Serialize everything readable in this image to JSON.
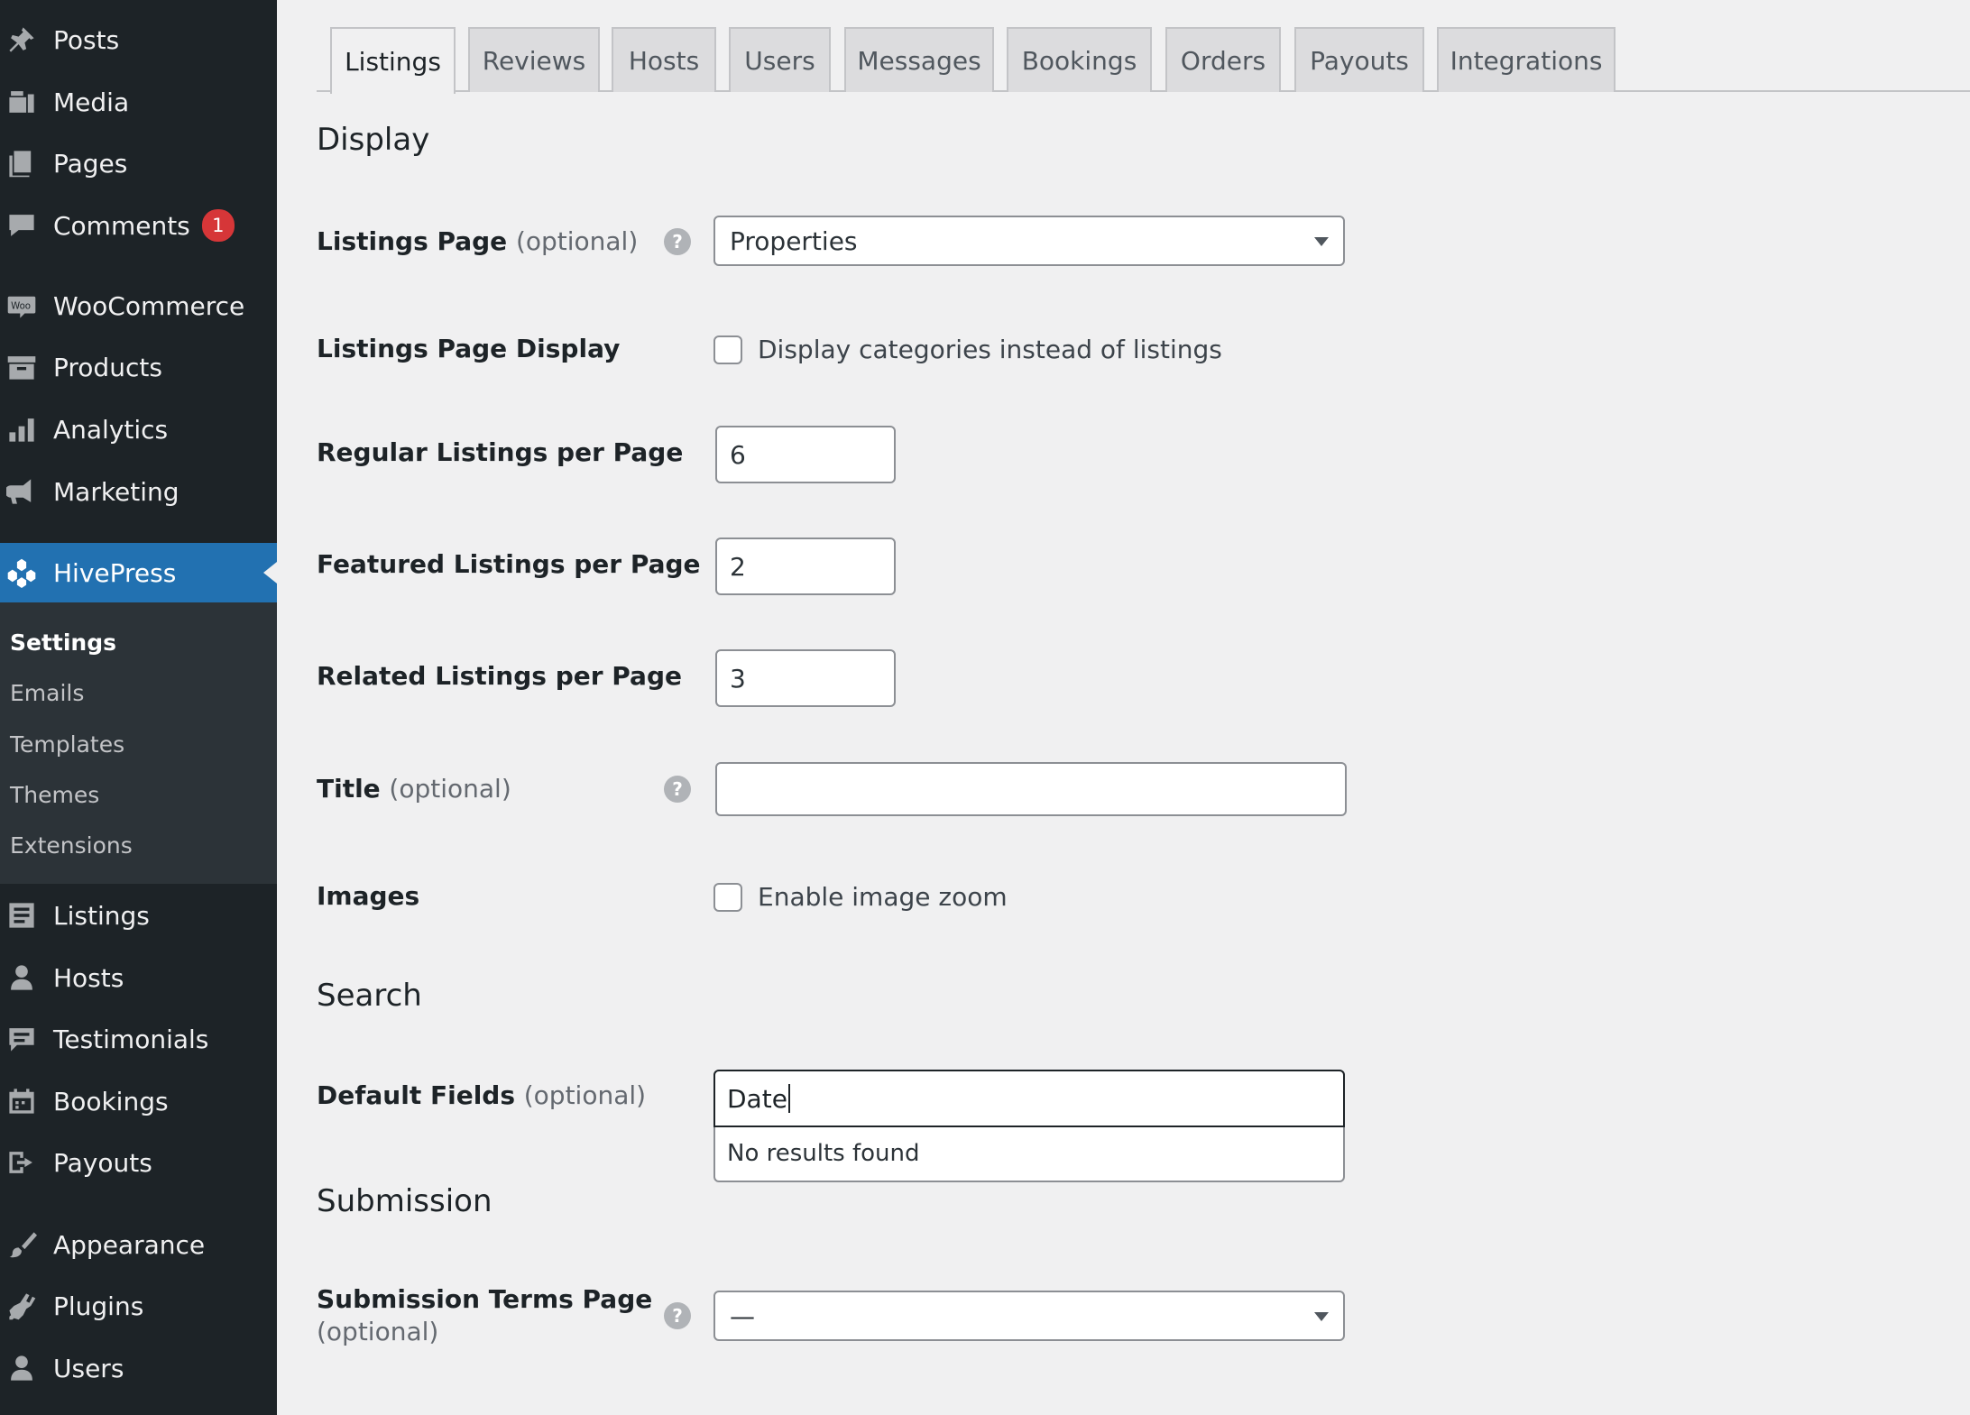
{
  "sidebar": {
    "items": [
      {
        "label": "Posts",
        "icon": "pin-icon"
      },
      {
        "label": "Media",
        "icon": "media-icon"
      },
      {
        "label": "Pages",
        "icon": "pages-icon"
      },
      {
        "label": "Comments",
        "icon": "comments-icon",
        "badge": "1"
      },
      {
        "label": "WooCommerce",
        "icon": "woo-icon"
      },
      {
        "label": "Products",
        "icon": "archive-icon"
      },
      {
        "label": "Analytics",
        "icon": "chart-bar-icon"
      },
      {
        "label": "Marketing",
        "icon": "megaphone-icon"
      },
      {
        "label": "HivePress",
        "icon": "hivepress-icon"
      },
      {
        "label": "Listings",
        "icon": "list-icon"
      },
      {
        "label": "Hosts",
        "icon": "person-icon"
      },
      {
        "label": "Testimonials",
        "icon": "testimonial-icon"
      },
      {
        "label": "Bookings",
        "icon": "calendar-icon"
      },
      {
        "label": "Payouts",
        "icon": "exit-icon"
      },
      {
        "label": "Appearance",
        "icon": "brush-icon"
      },
      {
        "label": "Plugins",
        "icon": "plugin-icon"
      },
      {
        "label": "Users",
        "icon": "users-icon"
      }
    ],
    "submenu": [
      "Settings",
      "Emails",
      "Templates",
      "Themes",
      "Extensions"
    ]
  },
  "tabs": [
    "Listings",
    "Reviews",
    "Hosts",
    "Users",
    "Messages",
    "Bookings",
    "Orders",
    "Payouts",
    "Integrations"
  ],
  "sections": {
    "display": "Display",
    "search": "Search",
    "submission": "Submission"
  },
  "fields": {
    "listings_page": {
      "label": "Listings Page",
      "optional": "(optional)",
      "value": "Properties"
    },
    "listings_page_display": {
      "label": "Listings Page Display",
      "checkbox_label": "Display categories instead of listings"
    },
    "regular_per_page": {
      "label": "Regular Listings per Page",
      "value": "6"
    },
    "featured_per_page": {
      "label": "Featured Listings per Page",
      "value": "2"
    },
    "related_per_page": {
      "label": "Related Listings per Page",
      "value": "3"
    },
    "title": {
      "label": "Title",
      "optional": "(optional)",
      "value": ""
    },
    "images": {
      "label": "Images",
      "checkbox_label": "Enable image zoom"
    },
    "default_fields": {
      "label": "Default Fields",
      "optional": "(optional)",
      "value": "Date",
      "dropdown_message": "No results found"
    },
    "submission_terms": {
      "label": "Submission Terms Page",
      "optional": "(optional)",
      "value": "—"
    }
  },
  "help_glyph": "?",
  "colors": {
    "sidebar_bg": "#1d2327",
    "active": "#2271b1",
    "badge": "#d63638",
    "page_bg": "#f0f0f1"
  }
}
